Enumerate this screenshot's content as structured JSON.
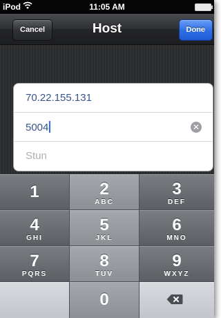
{
  "status_bar": {
    "carrier": "iPod",
    "time": "11:05 AM"
  },
  "nav_bar": {
    "title": "Host",
    "cancel_label": "Cancel",
    "done_label": "Done"
  },
  "form": {
    "host": "70.22.155.131",
    "port": "5004",
    "stun_placeholder": "Stun"
  },
  "keypad": {
    "keys": [
      {
        "digit": "1",
        "letters": ""
      },
      {
        "digit": "2",
        "letters": "ABC"
      },
      {
        "digit": "3",
        "letters": "DEF"
      },
      {
        "digit": "4",
        "letters": "GHI"
      },
      {
        "digit": "5",
        "letters": "JKL"
      },
      {
        "digit": "6",
        "letters": "MNO"
      },
      {
        "digit": "7",
        "letters": "PQRS"
      },
      {
        "digit": "8",
        "letters": "TUV"
      },
      {
        "digit": "9",
        "letters": "WXYZ"
      },
      {
        "digit": "0",
        "letters": ""
      }
    ],
    "delete_icon": "backspace-icon"
  },
  "colors": {
    "done_button": "#2e6fe5",
    "text_field": "#38548a",
    "caret": "#2e6fe5"
  }
}
